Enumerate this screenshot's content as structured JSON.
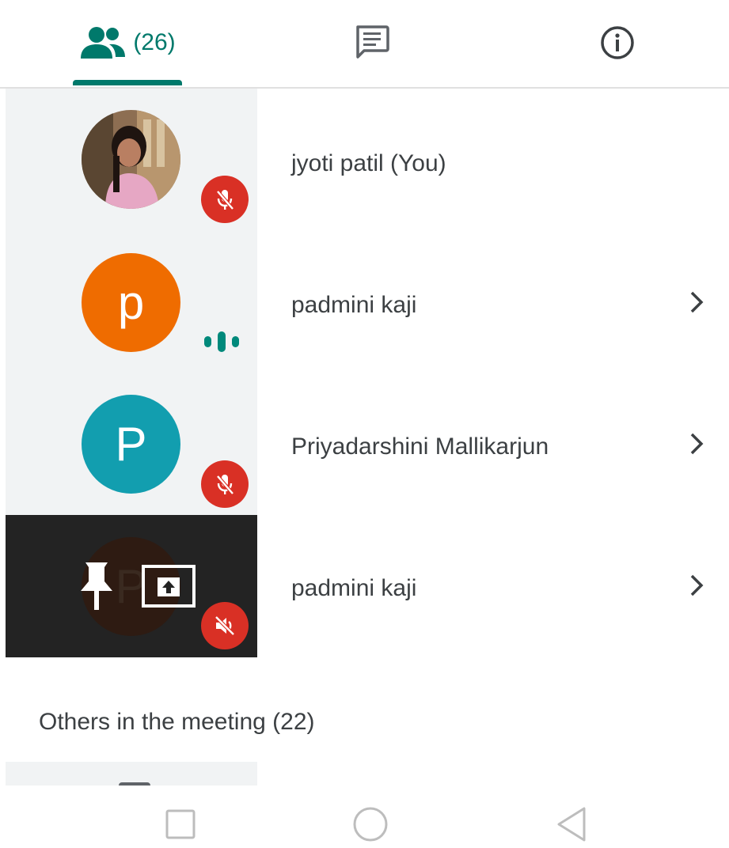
{
  "tabs": {
    "people_count": "(26)",
    "active_color": "#00796b",
    "icons": [
      "people-icon",
      "chat-icon",
      "info-icon"
    ]
  },
  "participants": [
    {
      "name": "jyoti patil (You)",
      "avatar": "photo",
      "status": "muted"
    },
    {
      "name": "padmini kaji",
      "avatar_letter": "p",
      "avatar_color": "#ef6c00",
      "status": "speaking"
    },
    {
      "name": "Priyadarshini Mallikarjun",
      "avatar_letter": "P",
      "avatar_color": "#129eaf",
      "status": "muted"
    },
    {
      "name": "padmini kaji",
      "avatar_letter": "P",
      "status": "presenting-muted"
    }
  ],
  "others": {
    "label": "Others in the meeting (22)"
  },
  "colors": {
    "muted_badge": "#d93025",
    "speaking": "#00897b",
    "tile_bg": "#f1f3f4",
    "presenting_tile_bg": "#232323"
  },
  "navbar": [
    "square-icon",
    "circle-icon",
    "triangle-icon"
  ]
}
